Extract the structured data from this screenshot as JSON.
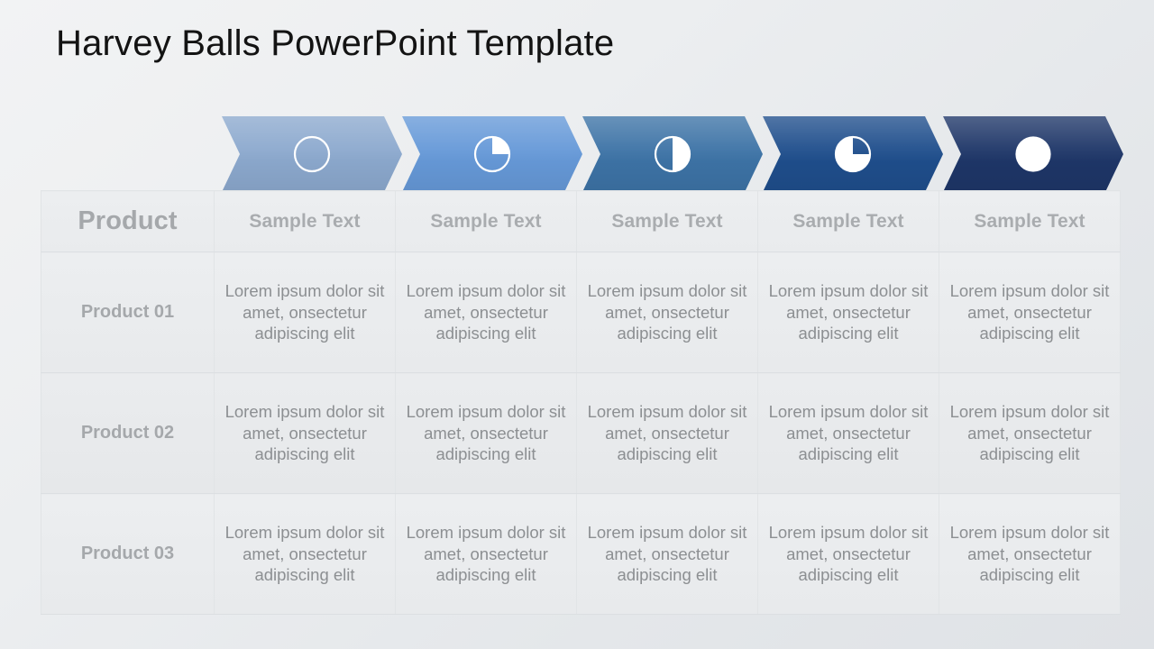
{
  "slide": {
    "title": "Harvey Balls PowerPoint Template",
    "background_color": "#e9ebed"
  },
  "chevrons": [
    {
      "name": "harvey-ball-0",
      "fill_percent": 0,
      "color": "#8ca9ce",
      "ball_style": "outline-empty"
    },
    {
      "name": "harvey-ball-25",
      "fill_percent": 25,
      "color": "#6699d8",
      "ball_style": "quarter"
    },
    {
      "name": "harvey-ball-50",
      "fill_percent": 50,
      "color": "#3d73a6",
      "ball_style": "half"
    },
    {
      "name": "harvey-ball-75",
      "fill_percent": 75,
      "color": "#1f4e8c",
      "ball_style": "three-quarter"
    },
    {
      "name": "harvey-ball-100",
      "fill_percent": 100,
      "color": "#1e3668",
      "ball_style": "full"
    }
  ],
  "table": {
    "headers": [
      "Product",
      "Sample Text",
      "Sample Text",
      "Sample Text",
      "Sample Text",
      "Sample Text"
    ],
    "body_text": "Lorem ipsum dolor sit amet, onsectetur adipiscing elit",
    "rows": [
      {
        "label": "Product  01",
        "cells": [
          "Lorem ipsum dolor sit amet, onsectetur adipiscing elit",
          "Lorem ipsum dolor sit amet, onsectetur adipiscing elit",
          "Lorem ipsum dolor sit amet, onsectetur adipiscing elit",
          "Lorem ipsum dolor sit amet, onsectetur adipiscing elit",
          "Lorem ipsum dolor sit amet, onsectetur adipiscing elit"
        ]
      },
      {
        "label": "Product  02",
        "cells": [
          "Lorem ipsum dolor sit amet, onsectetur adipiscing elit",
          "Lorem ipsum dolor sit amet, onsectetur adipiscing elit",
          "Lorem ipsum dolor sit amet, onsectetur adipiscing elit",
          "Lorem ipsum dolor sit amet, onsectetur adipiscing elit",
          "Lorem ipsum dolor sit amet, onsectetur adipiscing elit"
        ]
      },
      {
        "label": "Product  03",
        "cells": [
          "Lorem ipsum dolor sit amet, onsectetur adipiscing elit",
          "Lorem ipsum dolor sit amet, onsectetur adipiscing elit",
          "Lorem ipsum dolor sit amet, onsectetur adipiscing elit",
          "Lorem ipsum dolor sit amet, onsectetur adipiscing elit",
          "Lorem ipsum dolor sit amet, onsectetur adipiscing elit"
        ]
      }
    ]
  }
}
